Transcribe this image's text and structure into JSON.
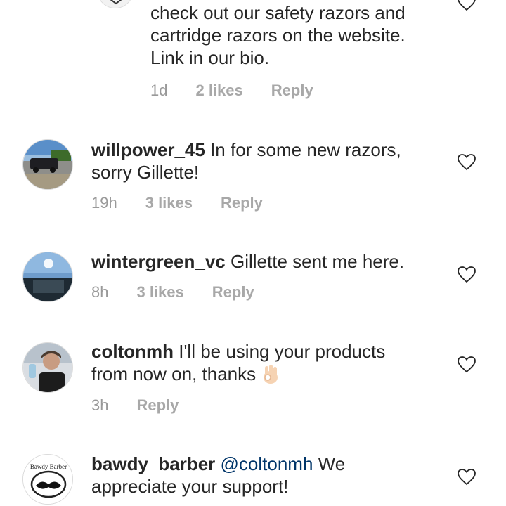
{
  "comments": [
    {
      "username": "",
      "text": "check out our safety razors and cartridge razors on the website. Link in our bio.",
      "lines": [
        "check out our safety razors and",
        "cartridge razors on the website.",
        "Link in our bio."
      ],
      "time": "1d",
      "likes": "2 likes",
      "reply": "Reply"
    },
    {
      "username": "willpower_45",
      "text_line1": "In for some new razors,",
      "text_line2": "sorry Gillette!",
      "time": "19h",
      "likes": "3 likes",
      "reply": "Reply"
    },
    {
      "username": "wintergreen_vc",
      "text_line1": "Gillette sent me here.",
      "time": "8h",
      "likes": "3 likes",
      "reply": "Reply"
    },
    {
      "username": "coltonmh",
      "text_line1": "I'll be using your products",
      "text_line2": "from now on, thanks",
      "emoji": "ok-hand-emoji",
      "time": "3h",
      "reply": "Reply"
    },
    {
      "username": "bawdy_barber",
      "mention": "@coltonmh",
      "text_line1": "We",
      "text_line2": "appreciate your support!",
      "avatar_logo_text": "Bawdy Barber"
    }
  ],
  "icons": {
    "like": "heart-outline-icon",
    "ok": "ok-hand-emoji"
  },
  "colors": {
    "text": "#262626",
    "meta": "#999999",
    "mention": "#003569",
    "heart": "#262626"
  }
}
